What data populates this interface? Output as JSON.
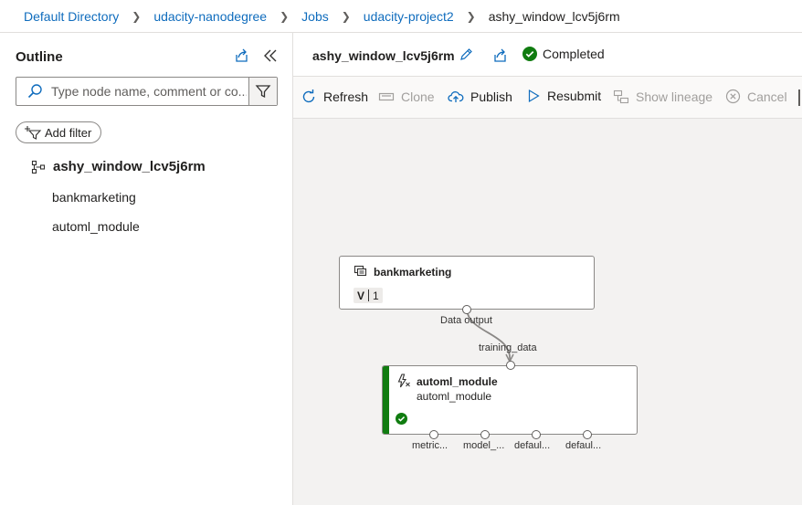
{
  "breadcrumb": {
    "items": [
      "Default Directory",
      "udacity-nanodegree",
      "Jobs",
      "udacity-project2",
      "ashy_window_lcv5j6rm"
    ]
  },
  "outline": {
    "title": "Outline",
    "search_placeholder": "Type node name, comment or co...",
    "add_filter_label": "Add filter",
    "tree": {
      "root": "ashy_window_lcv5j6rm",
      "children": [
        "bankmarketing",
        "automl_module"
      ]
    }
  },
  "job": {
    "title": "ashy_window_lcv5j6rm",
    "status": "Completed",
    "status_color": "#107c10"
  },
  "toolbar": {
    "refresh": "Refresh",
    "clone": "Clone",
    "publish": "Publish",
    "resubmit": "Resubmit",
    "show_lineage": "Show lineage",
    "cancel": "Cancel"
  },
  "canvas": {
    "dataset_node": {
      "title": "bankmarketing",
      "version_prefix": "V",
      "version": "1",
      "output_port": "Data output"
    },
    "module_node": {
      "title": "automl_module",
      "subtitle": "automl_module",
      "input_port": "training_data",
      "output_ports": [
        "metric...",
        "model_...",
        "defaul...",
        "defaul..."
      ]
    }
  },
  "colors": {
    "accent": "#0f6cbd",
    "success": "#107c10"
  }
}
